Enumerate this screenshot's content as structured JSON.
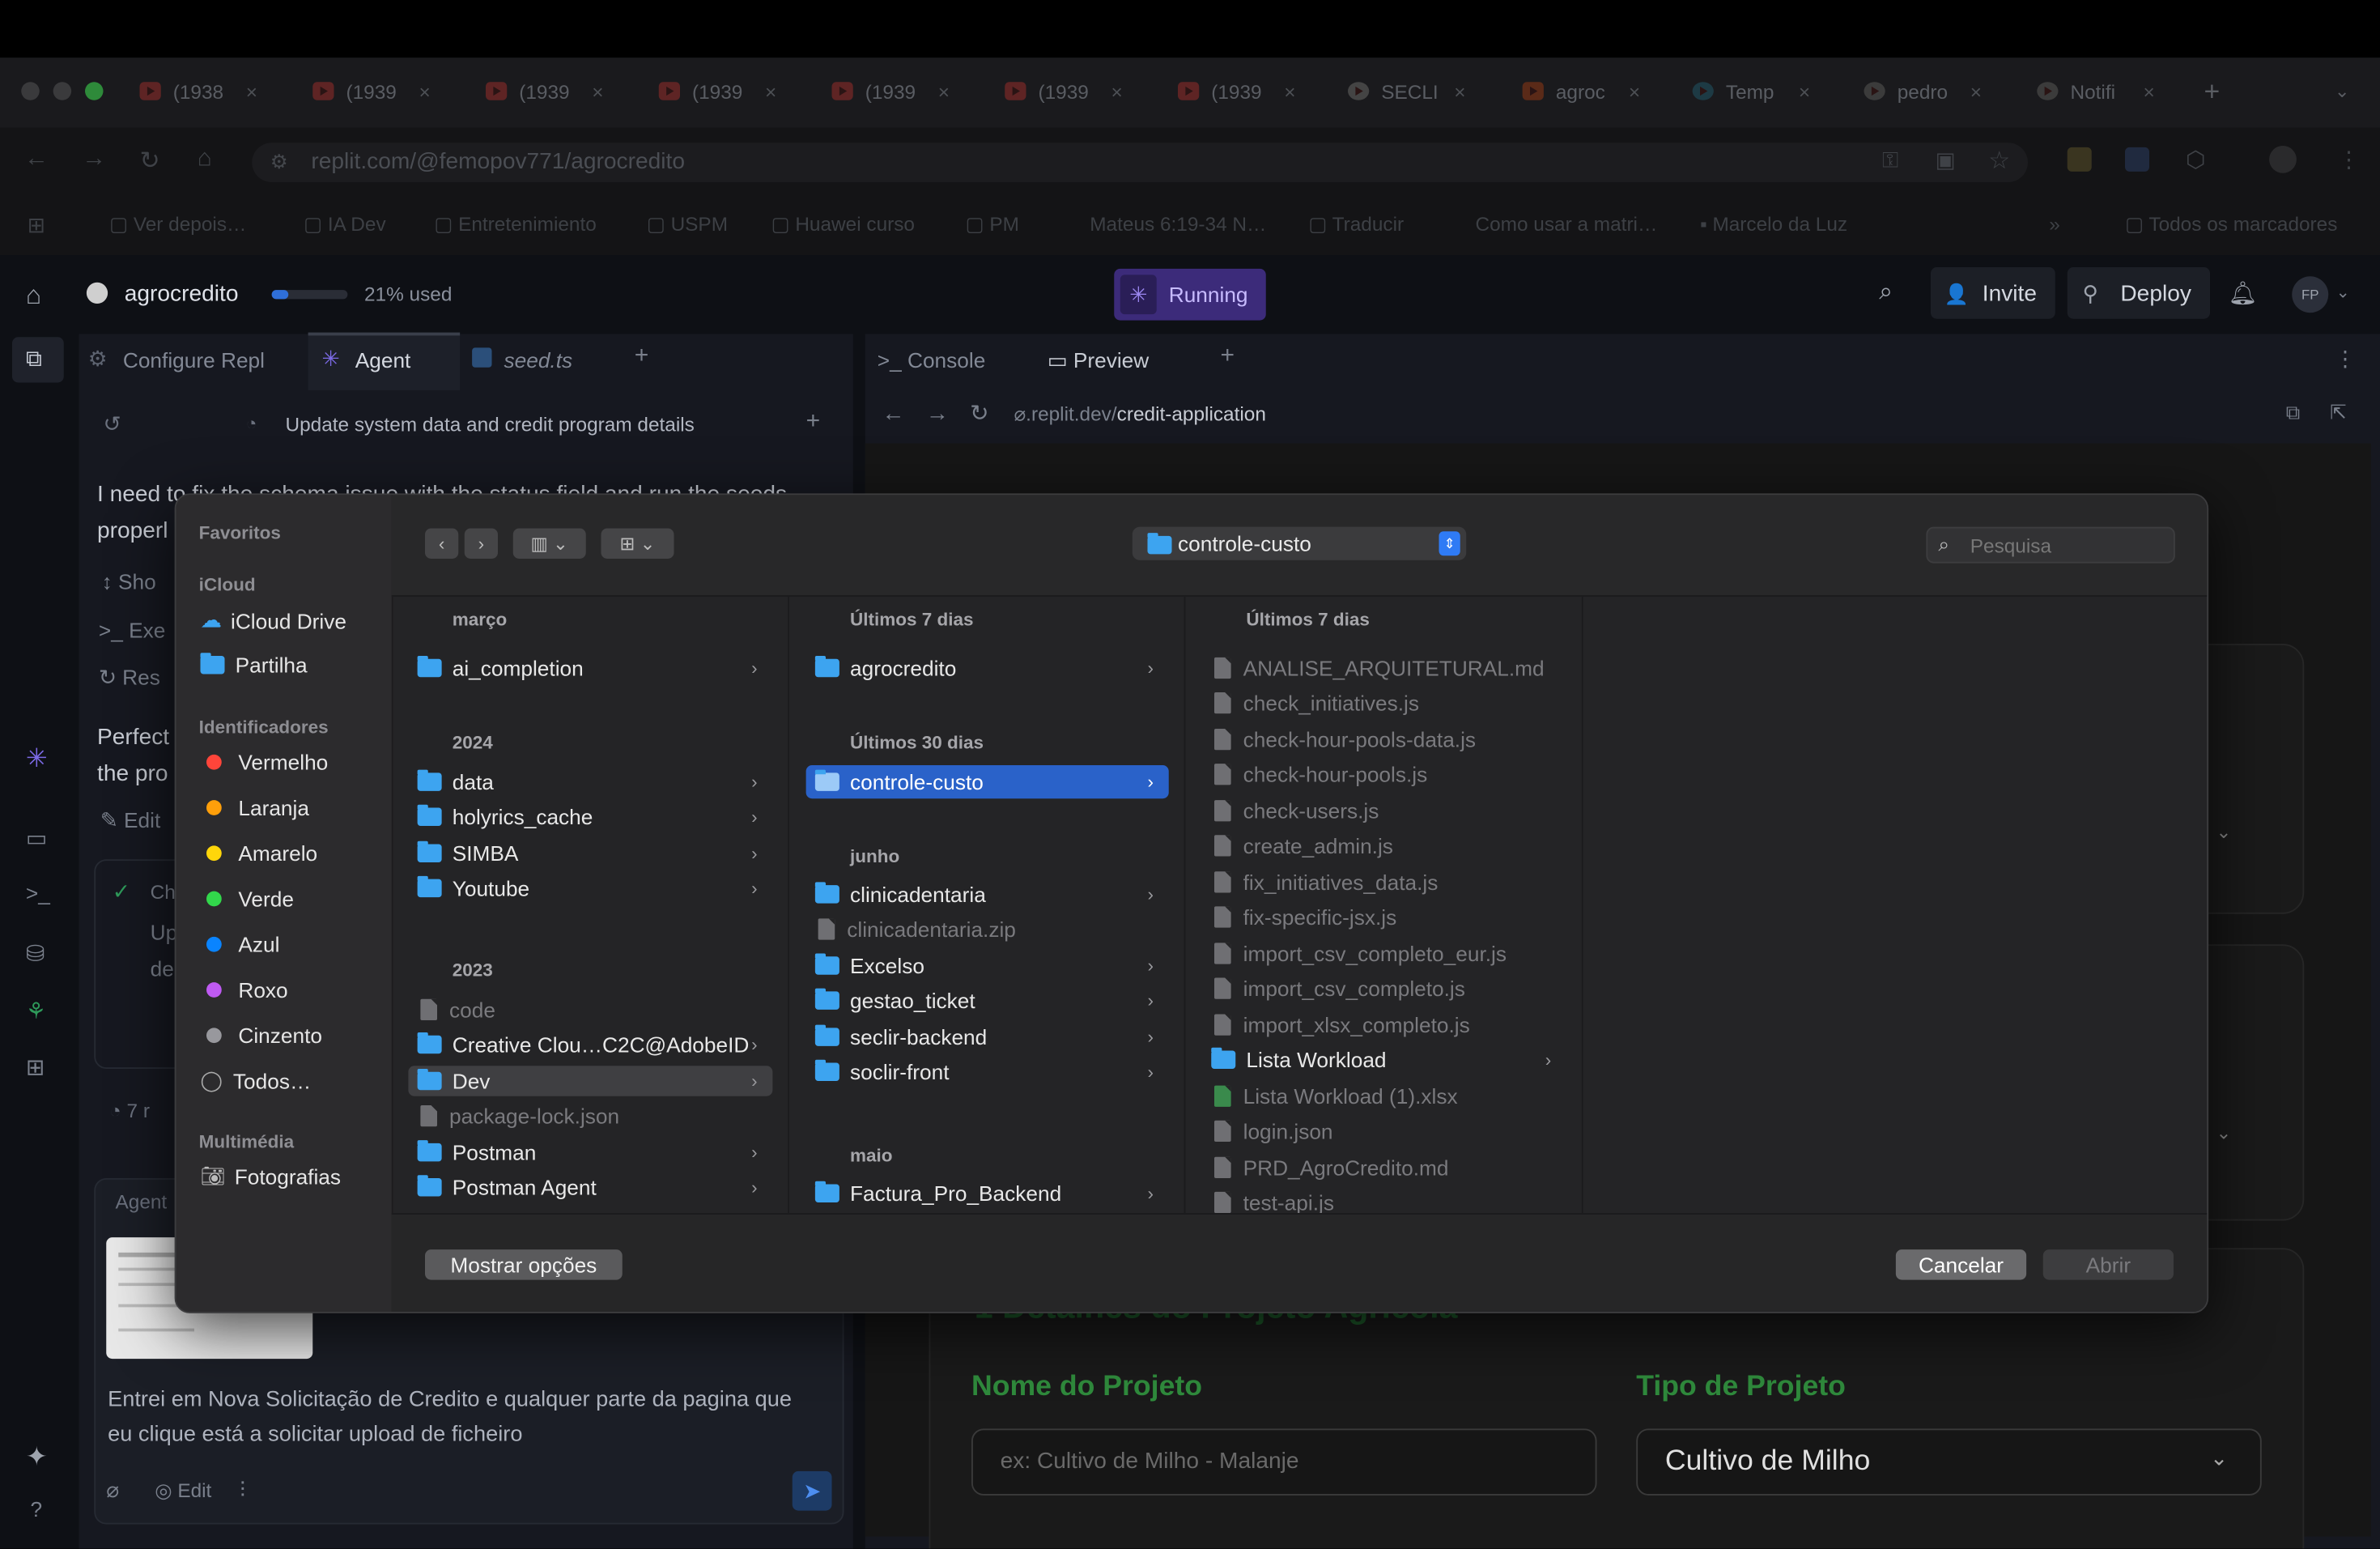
{
  "browser": {
    "tabs": [
      {
        "title": "(1938"
      },
      {
        "title": "(1939"
      },
      {
        "title": "(1939"
      },
      {
        "title": "(1939"
      },
      {
        "title": "(1939"
      },
      {
        "title": "(1939"
      },
      {
        "title": "(1939"
      },
      {
        "title": "SECLI"
      },
      {
        "title": "agroc"
      },
      {
        "title": "Temp"
      },
      {
        "title": "pedro"
      },
      {
        "title": "Notifi"
      }
    ],
    "tab_close": "×",
    "new_tab": "+",
    "url": "replit.com/@femopov771/agrocredito",
    "bookmarks": [
      "Ver depois…",
      "IA Dev",
      "Entretenimiento",
      "USPM",
      "Huawei curso",
      "PM",
      "Mateus 6:19-34 N…",
      "Traducir",
      "Como usar a matri…",
      "Marcelo da Luz"
    ],
    "bookmarks_more": "»",
    "all_bookmarks": "Todos os marcadores"
  },
  "replit": {
    "project_name": "agrocredito",
    "usage": "21% used",
    "usage_fraction": 0.21,
    "running_label": "Running",
    "invite_label": "Invite",
    "deploy_label": "Deploy",
    "avatar": "FP",
    "left_tabs": [
      "Configure Repl",
      "Agent",
      "seed.ts"
    ],
    "add_tab": "+",
    "right_tabs": [
      "Console",
      "Preview"
    ],
    "chat_title": "Update system data and credit program details",
    "chat_text_1": "I need to fix the schema issue with the status field and run the seeds",
    "chat_text_2": "properl",
    "chat_actions": [
      "Sho",
      "Exe",
      "Res"
    ],
    "chat_text_3": "Perfect",
    "chat_text_4": "the pro",
    "chat_edit": "Edit",
    "checkpoint": "Ch",
    "checkpoint_sub1": "Up",
    "checkpoint_sub2": "de",
    "counter": "7 r",
    "agent_label": "Agent",
    "input_text": "Entrei em Nova Solicitação de Credito e qualquer parte da pagina que eu clique está a solicitar upload de ficheiro",
    "input_edit": "Edit",
    "preview_url_prefix": ".replit.dev/",
    "preview_url_path": "credit-application",
    "help": "?"
  },
  "webpage": {
    "section_title": "1  Detalhes do Projeto Agrícola",
    "project_name_label": "Nome do Projeto",
    "project_name_placeholder": "ex: Cultivo de Milho - Malanje",
    "project_type_label": "Tipo de Projeto",
    "project_type_value": "Cultivo de Milho"
  },
  "dialog": {
    "location": "controle-custo",
    "search_placeholder": "Pesquisa",
    "sidebar": {
      "favorites_header": "Favoritos",
      "icloud_header": "iCloud",
      "icloud_items": [
        "iCloud Drive",
        "Partilha"
      ],
      "tags_header": "Identificadores",
      "tags": [
        {
          "label": "Vermelho",
          "color": "#ff453a"
        },
        {
          "label": "Laranja",
          "color": "#ff9f0a"
        },
        {
          "label": "Amarelo",
          "color": "#ffd60a"
        },
        {
          "label": "Verde",
          "color": "#32d74b"
        },
        {
          "label": "Azul",
          "color": "#0a84ff"
        },
        {
          "label": "Roxo",
          "color": "#bf5af2"
        },
        {
          "label": "Cinzento",
          "color": "#98989d"
        }
      ],
      "all_tags": "Todos…",
      "media_header": "Multimédia",
      "media_items": [
        "Fotografias"
      ]
    },
    "column1": {
      "group1": "março",
      "items1": [
        {
          "name": "ai_completion",
          "type": "folder"
        }
      ],
      "group2": "2024",
      "items2": [
        {
          "name": "data",
          "type": "folder"
        },
        {
          "name": "holyrics_cache",
          "type": "folder"
        },
        {
          "name": "SIMBA",
          "type": "folder"
        },
        {
          "name": "Youtube",
          "type": "folder"
        }
      ],
      "group3": "2023",
      "items3": [
        {
          "name": "code",
          "type": "file"
        },
        {
          "name": "Creative Clou…C2C@AdobeID",
          "type": "folder"
        },
        {
          "name": "Dev",
          "type": "folder"
        },
        {
          "name": "package-lock.json",
          "type": "file"
        },
        {
          "name": "Postman",
          "type": "folder"
        },
        {
          "name": "Postman Agent",
          "type": "folder"
        }
      ]
    },
    "column2": {
      "group1": "Últimos 7 dias",
      "items1": [
        {
          "name": "agrocredito",
          "type": "folder"
        }
      ],
      "group2": "Últimos 30 dias",
      "items2": [
        {
          "name": "controle-custo",
          "type": "folder"
        }
      ],
      "group3": "junho",
      "items3": [
        {
          "name": "clinicadentaria",
          "type": "folder"
        },
        {
          "name": "clinicadentaria.zip",
          "type": "file"
        },
        {
          "name": "Excelso",
          "type": "folder"
        },
        {
          "name": "gestao_ticket",
          "type": "folder"
        },
        {
          "name": "seclir-backend",
          "type": "folder"
        },
        {
          "name": "soclir-front",
          "type": "folder"
        }
      ],
      "group4": "maio",
      "items4": [
        {
          "name": "Factura_Pro_Backend",
          "type": "folder"
        }
      ]
    },
    "column3": {
      "group1": "Últimos 7 dias",
      "items": [
        {
          "name": "ANALISE_ARQUITETURAL.md",
          "type": "file"
        },
        {
          "name": "check_initiatives.js",
          "type": "file"
        },
        {
          "name": "check-hour-pools-data.js",
          "type": "file"
        },
        {
          "name": "check-hour-pools.js",
          "type": "file"
        },
        {
          "name": "check-users.js",
          "type": "file"
        },
        {
          "name": "create_admin.js",
          "type": "file"
        },
        {
          "name": "fix_initiatives_data.js",
          "type": "file"
        },
        {
          "name": "fix-specific-jsx.js",
          "type": "file"
        },
        {
          "name": "import_csv_completo_eur.js",
          "type": "file"
        },
        {
          "name": "import_csv_completo.js",
          "type": "file"
        },
        {
          "name": "import_xlsx_completo.js",
          "type": "file"
        },
        {
          "name": "Lista Workload",
          "type": "folder"
        },
        {
          "name": "Lista Workload (1).xlsx",
          "type": "xlsx"
        },
        {
          "name": "login.json",
          "type": "file"
        },
        {
          "name": "PRD_AgroCredito.md",
          "type": "file"
        },
        {
          "name": "test-api.js",
          "type": "file"
        }
      ]
    },
    "show_options": "Mostrar opções",
    "cancel": "Cancelar",
    "open": "Abrir"
  }
}
